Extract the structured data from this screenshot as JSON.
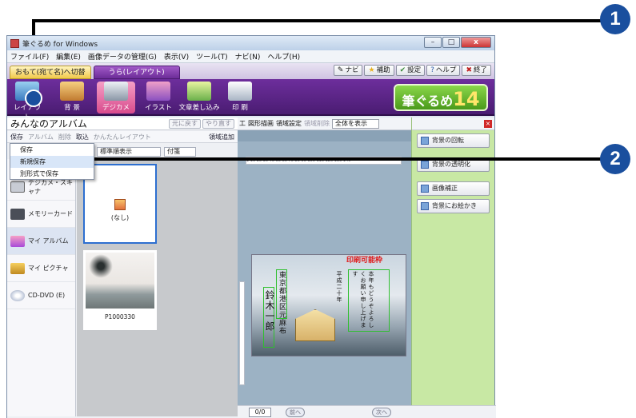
{
  "window": {
    "title": "筆ぐるめ for Windows",
    "controls": [
      "–",
      "□",
      "x"
    ]
  },
  "menu": [
    "ファイル(F)",
    "編集(E)",
    "画像データの管理(G)",
    "表示(V)",
    "ツール(T)",
    "ナビ(N)",
    "ヘルプ(H)"
  ],
  "tabs": {
    "tab1": "おもて(宛て名)へ切替",
    "tab2": "うら(レイアウト)"
  },
  "top_buttons": [
    "ナビ",
    "補助",
    "設定",
    "ヘルプ",
    "終了"
  ],
  "ribbon": {
    "items": [
      "レイアウト",
      "背 景",
      "デジカメ",
      "イラスト",
      "文章差し込み",
      "印 刷"
    ],
    "logo": "筆ぐるめ",
    "logo_version": "14"
  },
  "album": {
    "title": "みんなのアルバム",
    "undo": "元に戻す",
    "redo": "やり直す",
    "toolbar": [
      "保存",
      "アルバム",
      "削除",
      "取込",
      "かんたんレイアウト"
    ],
    "add": "領域追加",
    "dropdown": [
      "保存",
      "新規保存",
      "別形式で保存"
    ],
    "view_label": "表示",
    "view_select": "標準順表示",
    "sort_label": "付箋"
  },
  "sidebar": [
    "デジカメ・スキャナ",
    "メモリーカード",
    "マイ アルバム",
    "マイ ピクチャ",
    "CD-DVD (E)"
  ],
  "thumbnails": [
    {
      "label": "(なし)"
    },
    {
      "label": "P1000330"
    }
  ],
  "canvas": {
    "toolbar": [
      "工",
      "図形描画",
      "領域設定",
      "領域削除"
    ],
    "zoom": "全体を表示",
    "print_label": "印刷可能枠",
    "ruler": "1 10 20 30 40 50 60 70 80 90 100 110 120 130 140",
    "address_text": "東京都港区元麻布",
    "name_text": "鈴木一郎",
    "greeting_text": "本年もどうぞよろしくお願い申し上げます",
    "year_text": "平成二十年",
    "page": "0/0",
    "prev": "前へ",
    "next": "次へ"
  },
  "right_panel": [
    "背景の回転",
    "背景の透明化",
    "画像補正",
    "背景にお絵かき"
  ],
  "callouts": [
    "1",
    "2"
  ],
  "colors": {
    "ribbon": "#5a2486",
    "accent_pink": "#d84a8c",
    "callout": "#1a4f9e",
    "panel_green": "#c8e8a4"
  }
}
